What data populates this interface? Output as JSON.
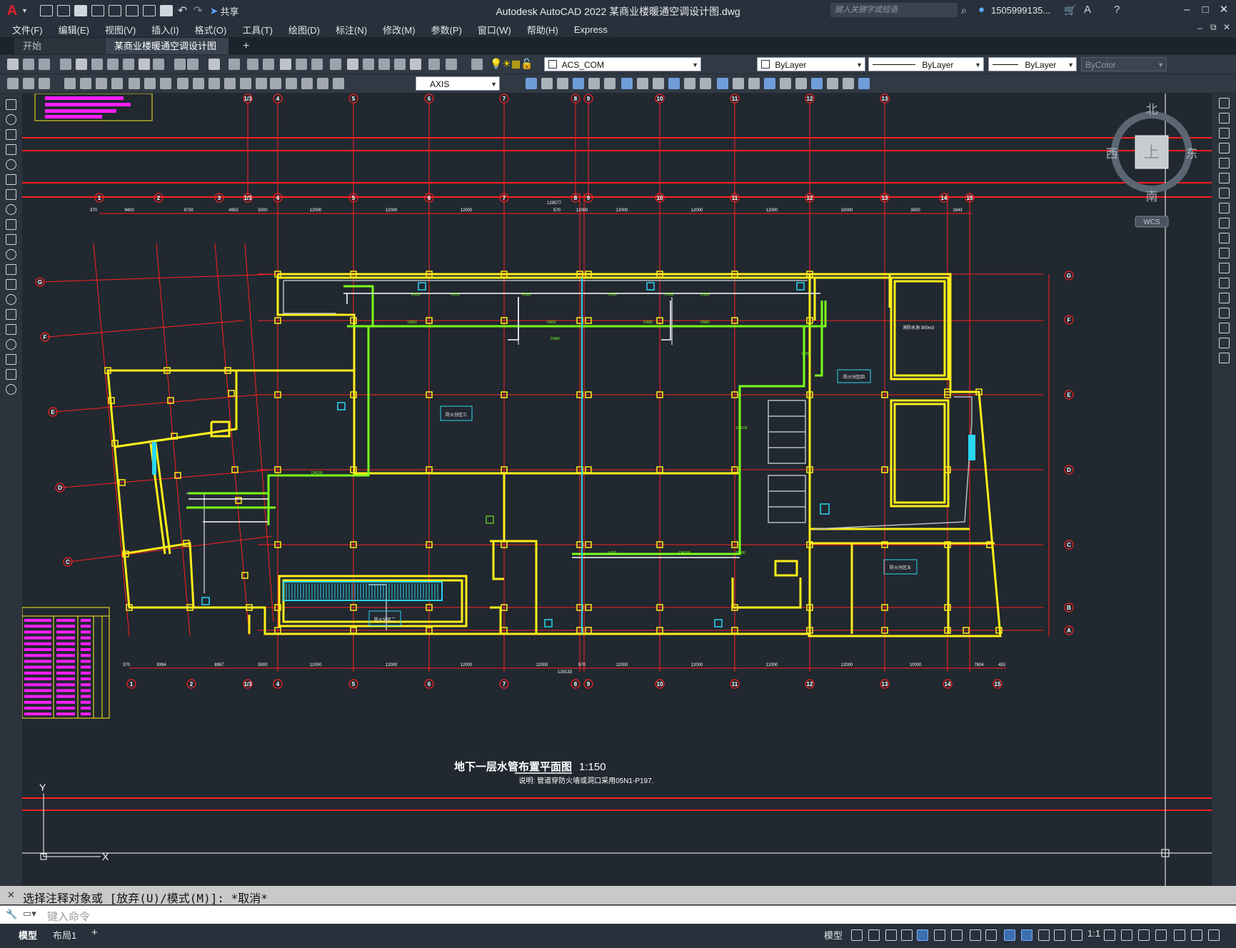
{
  "app": {
    "title": "Autodesk AutoCAD 2022    某商业楼暖通空调设计图.dwg",
    "search_placeholder": "键入关键字或短语",
    "user": "1505999135...",
    "share_label": "共享"
  },
  "menu": [
    "文件(F)",
    "编辑(E)",
    "视图(V)",
    "插入(I)",
    "格式(O)",
    "工具(T)",
    "绘图(D)",
    "标注(N)",
    "修改(M)",
    "参数(P)",
    "窗口(W)",
    "帮助(H)",
    "Express"
  ],
  "tabs": {
    "start": "开始",
    "doc": "某商业楼暖通空调设计图*"
  },
  "toolbar": {
    "layer_combo": "ACS_COM",
    "color_combo": "ByLayer",
    "linetype_combo": "ByLayer",
    "lineweight_combo": "ByLayer",
    "plotstyle_combo": "ByColor",
    "dimstyle_combo": "AXIS"
  },
  "viewcube": {
    "north": "北",
    "south": "南",
    "east": "东",
    "west": "西",
    "top": "上",
    "wcs": "WCS"
  },
  "drawing": {
    "title": "地下一层水管布置平面图",
    "scale": "1:150",
    "subtitle": "说明: 管道穿防火墙或洞口采用05N1-P197.",
    "axis_top": [
      "1",
      "2",
      "3",
      "1/3",
      "4",
      "5",
      "6",
      "7",
      "8",
      "9",
      "10",
      "11",
      "12",
      "13",
      "14",
      "15"
    ],
    "axis_bottom": [
      "1",
      "2",
      "1/3",
      "4",
      "5",
      "6",
      "7",
      "8",
      "9",
      "10",
      "11",
      "12",
      "13",
      "14",
      "15"
    ],
    "axis_right": [
      "G",
      "F",
      "E",
      "D",
      "C",
      "B",
      "A"
    ],
    "axis_left": [
      "G",
      "F",
      "E",
      "D",
      "C"
    ],
    "axis_partial_top": [
      "1/3",
      "4",
      "5",
      "6",
      "7",
      "8",
      "9",
      "10",
      "11",
      "12",
      "13"
    ],
    "dims_top": [
      "370",
      "9400",
      "9730",
      "4953",
      "5000",
      "12000",
      "12000",
      "12000",
      "570",
      "12000",
      "12000",
      "12000",
      "12000",
      "10000",
      "3500",
      "1643"
    ],
    "dim_total_top": "129577",
    "dims_bottom": [
      "370",
      "9394",
      "8967",
      "5000",
      "12000",
      "12000",
      "12000",
      "12000",
      "570",
      "12000",
      "12000",
      "12000",
      "12000",
      "10000",
      "7804",
      "453"
    ],
    "dim_total_bottom": "129133",
    "pipe_labels": [
      "DN32",
      "DN25",
      "DN32",
      "DN25",
      "DN50",
      "DN32",
      "DN50",
      "DN65",
      "DN80",
      "DN100",
      "DN50",
      "DN80",
      "DN200",
      "DN100",
      "0.003",
      "0.003",
      "0.003"
    ],
    "room_area_1": "防火分区三",
    "room_area_2": "防火分区二",
    "room_area_3": "防火分区四",
    "room_area_4": "防火分区五",
    "tank_label": "消防水池 300m3",
    "ucs_x": "X",
    "ucs_y": "Y"
  },
  "command": {
    "history": "选择注释对象或 [放弃(U)/模式(M)]: *取消*",
    "placeholder": "键入命令"
  },
  "status": {
    "model_tab": "模型",
    "layout_tab": "布局1",
    "model_label": "模型",
    "scale": "1:1"
  },
  "colors": {
    "background": "#212830",
    "axis_red": "#ff1f1f",
    "wall_yellow": "#ffee1a",
    "pipe_green": "#7cff1a",
    "pipe_cyan": "#2ad6f0",
    "magenta": "#ff1fff",
    "accent_red": "#e0202a"
  }
}
